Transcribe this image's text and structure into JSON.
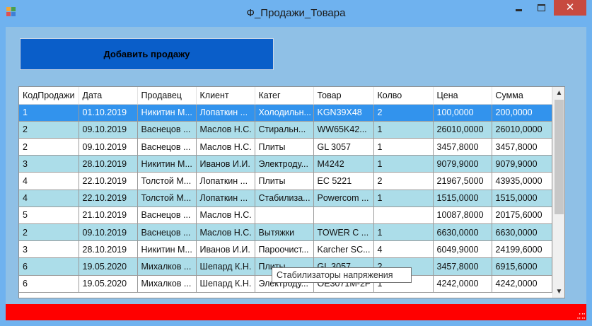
{
  "window": {
    "title": "Ф_Продажи_Товара",
    "close_glyph": "✕"
  },
  "toolbar": {
    "add_button_label": "Добавить продажу"
  },
  "grid": {
    "columns": [
      "КодПродажи",
      "Дата",
      "Продавец",
      "Клиент",
      "Катег",
      "Товар",
      "Колво",
      "Цена",
      "Сумма"
    ],
    "rows": [
      [
        "1",
        "01.10.2019",
        "Никитин М...",
        "Лопаткин ...",
        "Холодильн...",
        "KGN39X48",
        "2",
        "100,0000",
        "200,0000"
      ],
      [
        "2",
        "09.10.2019",
        "Васнецов ...",
        "Маслов Н.С.",
        "Стиральн...",
        "WW65K42...",
        "1",
        "26010,0000",
        "26010,0000"
      ],
      [
        "2",
        "09.10.2019",
        "Васнецов ...",
        "Маслов Н.С.",
        "Плиты",
        "GL 3057",
        "1",
        "3457,8000",
        "3457,8000"
      ],
      [
        "3",
        "28.10.2019",
        "Никитин М...",
        "Иванов И.И.",
        "Электроду...",
        "M4242",
        "1",
        "9079,9000",
        "9079,9000"
      ],
      [
        "4",
        "22.10.2019",
        "Толстой М...",
        "Лопаткин ...",
        "Плиты",
        "EC 5221",
        "2",
        "21967,5000",
        "43935,0000"
      ],
      [
        "4",
        "22.10.2019",
        "Толстой М...",
        "Лопаткин ...",
        "Стабилиза...",
        "Powercom ...",
        "1",
        "1515,0000",
        "1515,0000"
      ],
      [
        "5",
        "21.10.2019",
        "Васнецов ...",
        "Маслов Н.С.",
        "",
        "",
        "",
        "10087,8000",
        "20175,6000"
      ],
      [
        "2",
        "09.10.2019",
        "Васнецов ...",
        "Маслов Н.С.",
        "Вытяжки",
        "TOWER C ...",
        "1",
        "6630,0000",
        "6630,0000"
      ],
      [
        "3",
        "28.10.2019",
        "Никитин М...",
        "Иванов И.И.",
        "Пароочист...",
        "Karcher SC...",
        "4",
        "6049,9000",
        "24199,6000"
      ],
      [
        "6",
        "19.05.2020",
        "Михалков ...",
        "Шепард К.Н.",
        "Плиты",
        "GL 3057",
        "2",
        "3457,8000",
        "6915,6000"
      ],
      [
        "6",
        "19.05.2020",
        "Михалков ...",
        "Шепард К.Н.",
        "Электроду...",
        "OE3071M-2P",
        "1",
        "4242,0000",
        "4242,0000"
      ]
    ],
    "selected_row": 0,
    "tooltip": "Стабилизаторы напряжения"
  },
  "scrollbar": {
    "up_arrow": "▲",
    "down_arrow": "▼"
  },
  "colors": {
    "selected_row": "#3293ed",
    "alt_row": "#acdde9",
    "status_bar": "#ff0000",
    "button": "#0a5ec9"
  }
}
